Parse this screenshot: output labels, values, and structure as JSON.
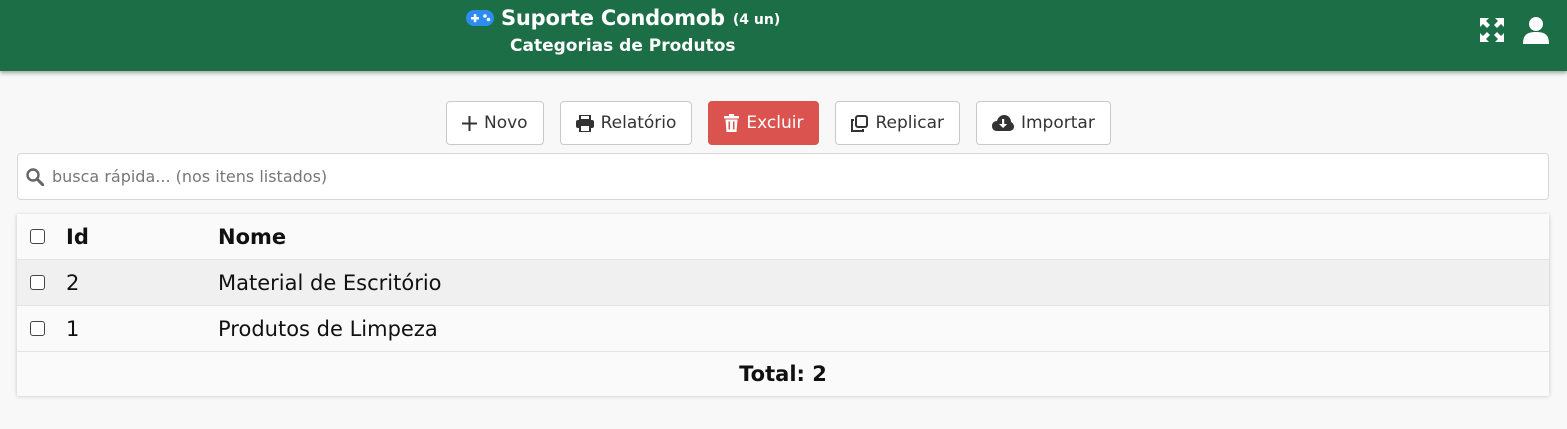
{
  "header": {
    "app_title": "Suporte Condomob",
    "count": "(4 un)",
    "subtitle": "Categorias de Produtos",
    "icons": [
      "gamepad-icon",
      "fullscreen-icon",
      "user-icon"
    ],
    "bar_color": "#1c6e47"
  },
  "toolbar": {
    "novo": "Novo",
    "relatorio": "Relatório",
    "excluir": "Excluir",
    "replicar": "Replicar",
    "importar": "Importar",
    "danger_color": "#da534f"
  },
  "search": {
    "placeholder": "busca rápida... (nos itens listados)",
    "value": ""
  },
  "table": {
    "columns": [
      "Id",
      "Nome"
    ],
    "rows": [
      {
        "id": "2",
        "nome": "Material de Escritório"
      },
      {
        "id": "1",
        "nome": "Produtos de Limpeza"
      }
    ],
    "total": "Total: 2"
  }
}
